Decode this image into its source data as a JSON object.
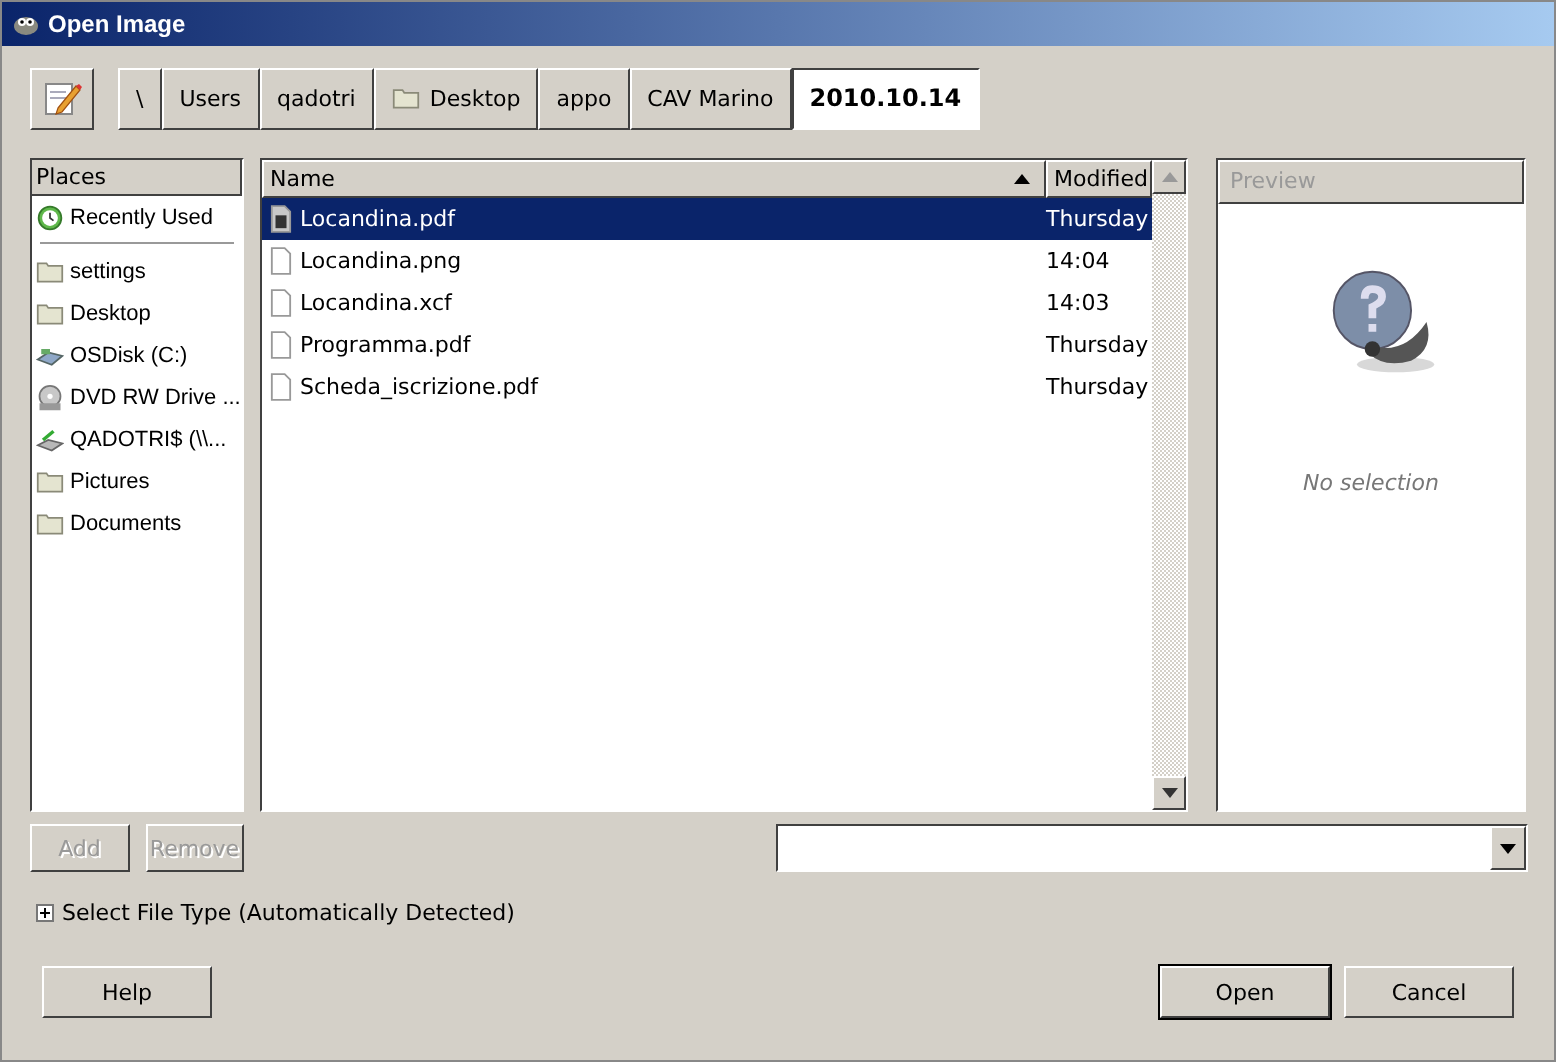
{
  "window": {
    "title": "Open Image"
  },
  "path_bar": {
    "segments": [
      {
        "label": "\\",
        "kind": "plain",
        "selected": false
      },
      {
        "label": "Users",
        "kind": "plain",
        "selected": false
      },
      {
        "label": "qadotri",
        "kind": "plain",
        "selected": false
      },
      {
        "label": "Desktop",
        "kind": "folder",
        "selected": false
      },
      {
        "label": "appo",
        "kind": "plain",
        "selected": false
      },
      {
        "label": "CAV Marino",
        "kind": "plain",
        "selected": false
      },
      {
        "label": "2010.10.14",
        "kind": "plain",
        "selected": true
      }
    ]
  },
  "places": {
    "header": "Places",
    "items": [
      {
        "label": "Recently Used",
        "kind": "recent"
      },
      {
        "label": "settings",
        "kind": "folder"
      },
      {
        "label": "Desktop",
        "kind": "folder"
      },
      {
        "label": "OSDisk (C:)",
        "kind": "drive"
      },
      {
        "label": "DVD RW Drive ...",
        "kind": "dvd"
      },
      {
        "label": "QADOTRI$ (\\\\...",
        "kind": "network"
      },
      {
        "label": "Pictures",
        "kind": "folder"
      },
      {
        "label": "Documents",
        "kind": "folder"
      }
    ],
    "buttons": [
      {
        "label": "Add",
        "disabled": true
      },
      {
        "label": "Remove",
        "disabled": true
      }
    ]
  },
  "files": {
    "columns": [
      "Name",
      "Modified"
    ],
    "rows": [
      {
        "name": "Locandina.pdf",
        "modified": "Thursday",
        "selected": true
      },
      {
        "name": "Locandina.png",
        "modified": "14:04",
        "selected": false
      },
      {
        "name": "Locandina.xcf",
        "modified": "14:03",
        "selected": false
      },
      {
        "name": "Programma.pdf",
        "modified": "Thursday",
        "selected": false
      },
      {
        "name": "Scheda_iscrizione.pdf",
        "modified": "Thursday",
        "selected": false
      }
    ]
  },
  "preview": {
    "header": "Preview",
    "message": "No selection"
  },
  "file_type": {
    "label": "Select File Type (Automatically Detected)",
    "expanded": false
  },
  "buttons": [
    {
      "label": "Help",
      "kind": "help"
    },
    {
      "label": "Open",
      "kind": "default"
    },
    {
      "label": "Cancel",
      "kind": "normal"
    }
  ]
}
